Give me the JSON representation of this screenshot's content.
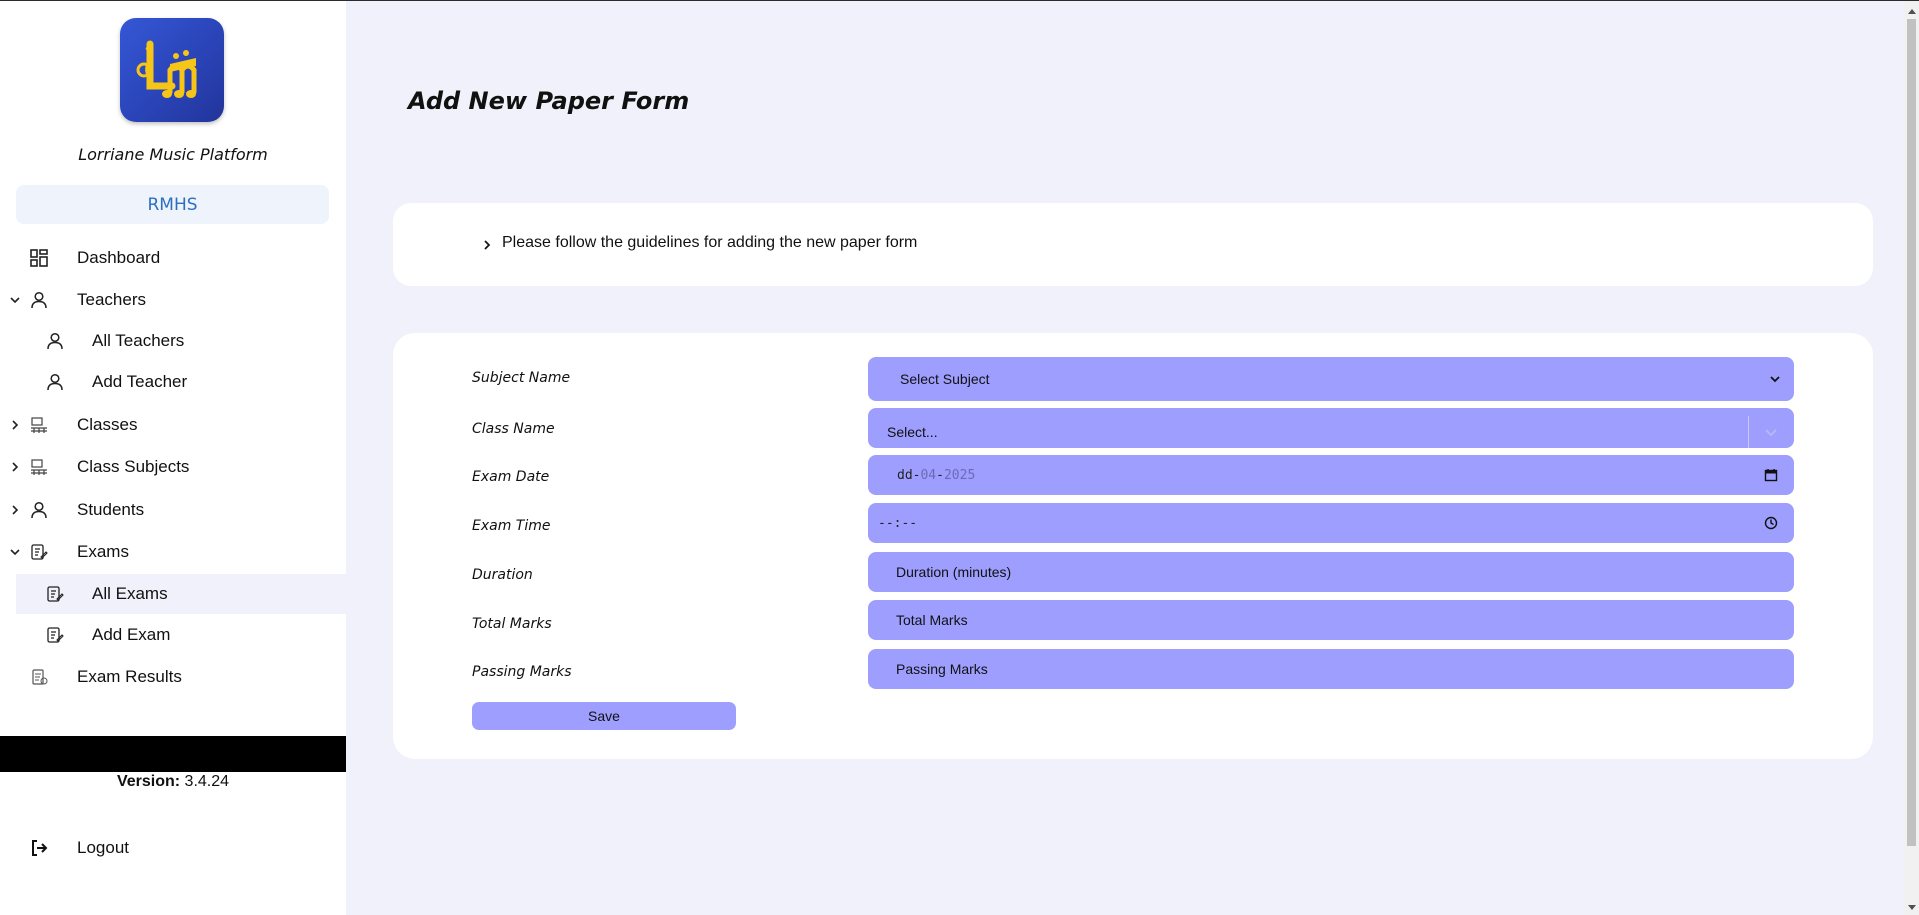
{
  "sidebar": {
    "platform_name": "Lorriane Music Platform",
    "school": "RMHS",
    "items": [
      {
        "label": "Dashboard",
        "icon": "dashboard-icon"
      },
      {
        "label": "Teachers",
        "icon": "user-icon",
        "expanded": true
      },
      {
        "label": "All Teachers",
        "icon": "user-icon"
      },
      {
        "label": "Add Teacher",
        "icon": "user-icon"
      },
      {
        "label": "Classes",
        "icon": "classes-icon",
        "expanded": false
      },
      {
        "label": "Class Subjects",
        "icon": "classes-icon",
        "expanded": false
      },
      {
        "label": "Students",
        "icon": "user-icon",
        "expanded": false
      },
      {
        "label": "Exams",
        "icon": "exam-icon",
        "expanded": true
      },
      {
        "label": "All Exams",
        "icon": "exam-icon",
        "active": true
      },
      {
        "label": "Add Exam",
        "icon": "exam-icon"
      },
      {
        "label": "Exam Results",
        "icon": "exam-results-icon"
      }
    ],
    "version_label": "Version:",
    "version_value": "3.4.24",
    "logout": "Logout"
  },
  "main": {
    "title": "Add New Paper Form",
    "guidelines": "Please follow the guidelines for adding the new paper form",
    "form": {
      "subject_label": "Subject Name",
      "subject_value": "Select Subject",
      "class_label": "Class Name",
      "class_placeholder": "Select...",
      "date_label": "Exam Date",
      "date_day": "dd",
      "date_month": "04",
      "date_year": "2025",
      "time_label": "Exam Time",
      "time_placeholder": "--:--",
      "duration_label": "Duration",
      "duration_placeholder": "Duration (minutes)",
      "total_label": "Total Marks",
      "total_placeholder": "Total Marks",
      "passing_label": "Passing Marks",
      "passing_placeholder": "Passing Marks",
      "save": "Save"
    }
  },
  "colors": {
    "field_bg": "#9d9efe",
    "page_bg": "#f0f1fa",
    "school_text": "#2d6fc0",
    "logo_bg": "#2f4fc9",
    "logo_glyph": "#f5c518"
  }
}
